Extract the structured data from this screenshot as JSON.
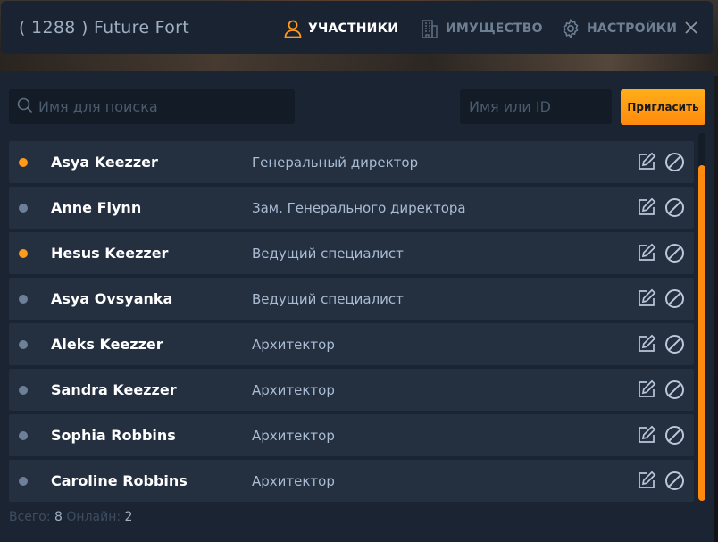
{
  "header": {
    "title": "( 1288 ) Future Fort",
    "tabs": [
      {
        "label": "УЧАСТНИКИ",
        "active": true,
        "icon": "user-icon"
      },
      {
        "label": "ИМУЩЕСТВО",
        "active": false,
        "icon": "building-icon"
      },
      {
        "label": "НАСТРОЙКИ",
        "active": false,
        "icon": "gear-icon"
      }
    ]
  },
  "search": {
    "placeholder": "Имя для поиска",
    "value": ""
  },
  "invite": {
    "placeholder": "Имя или ID",
    "value": "",
    "button_label": "Пригласить"
  },
  "members": [
    {
      "name": "Asya Keezzer",
      "role": "Генеральный директор",
      "online": true
    },
    {
      "name": "Anne Flynn",
      "role": "Зам. Генерального директора",
      "online": false
    },
    {
      "name": "Hesus Keezzer",
      "role": "Ведущий специалист",
      "online": true
    },
    {
      "name": "Asya Ovsyanka",
      "role": "Ведущий специалист",
      "online": false
    },
    {
      "name": "Aleks Keezzer",
      "role": "Архитектор",
      "online": false
    },
    {
      "name": "Sandra Keezzer",
      "role": "Архитектор",
      "online": false
    },
    {
      "name": "Sophia Robbins",
      "role": "Архитектор",
      "online": false
    },
    {
      "name": "Caroline Robbins",
      "role": "Архитектор",
      "online": false
    }
  ],
  "footer": {
    "total_label": "Всего:",
    "total_value": "8",
    "online_label": "Онлайн:",
    "online_value": "2"
  },
  "colors": {
    "accent": "#ff8a0d",
    "online_dot": "#ff9a1a",
    "offline_dot": "#6e7f9a"
  }
}
